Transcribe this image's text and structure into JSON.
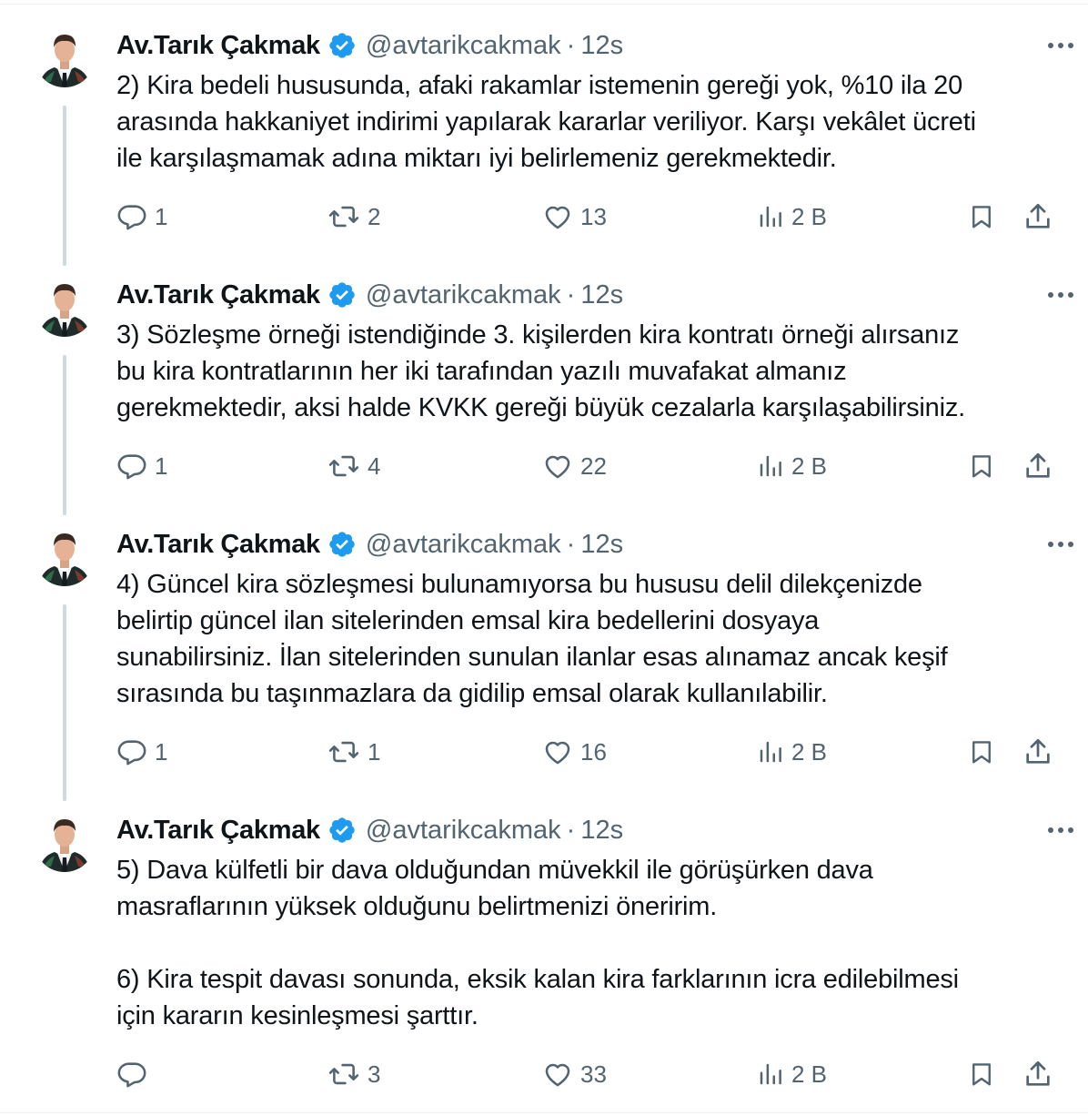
{
  "tweets": [
    {
      "name": "Av.Tarık Çakmak",
      "handle": "@avtarikcakmak",
      "separator": "·",
      "time": "12s",
      "lines": [
        "2) Kira bedeli hususunda, afaki rakamlar istemenin gereği yok, %10 ila 20",
        "arasında hakkaniyet indirimi yapılarak kararlar veriliyor. Karşı vekâlet ücreti",
        "ile karşılaşmamak adına miktarı iyi belirlemeniz gerekmektedir."
      ],
      "replies": "1",
      "retweets": "2",
      "likes": "13",
      "views": "2 B"
    },
    {
      "name": "Av.Tarık Çakmak",
      "handle": "@avtarikcakmak",
      "separator": "·",
      "time": "12s",
      "lines": [
        "3) Sözleşme örneği istendiğinde 3. kişilerden kira kontratı örneği alırsanız",
        "bu kira kontratlarının her iki tarafından yazılı muvafakat almanız",
        "gerekmektedir, aksi halde KVKK gereği büyük cezalarla karşılaşabilirsiniz."
      ],
      "replies": "1",
      "retweets": "4",
      "likes": "22",
      "views": "2 B"
    },
    {
      "name": "Av.Tarık Çakmak",
      "handle": "@avtarikcakmak",
      "separator": "·",
      "time": "12s",
      "lines": [
        "4) Güncel kira sözleşmesi bulunamıyorsa bu hususu delil dilekçenizde",
        "belirtip güncel ilan sitelerinden emsal kira bedellerini dosyaya",
        "sunabilirsiniz. İlan sitelerinden sunulan ilanlar esas alınamaz ancak keşif",
        "sırasında bu taşınmazlara da gidilip emsal olarak kullanılabilir."
      ],
      "replies": "1",
      "retweets": "1",
      "likes": "16",
      "views": "2 B"
    },
    {
      "name": "Av.Tarık Çakmak",
      "handle": "@avtarikcakmak",
      "separator": "·",
      "time": "12s",
      "lines": [
        "5) Dava külfetli bir dava olduğundan müvekkil ile görüşürken dava",
        "masraflarının yüksek olduğunu belirtmenizi öneririm.",
        "",
        "6) Kira tespit davası sonunda, eksik kalan kira farklarının icra edilebilmesi",
        "için kararın kesinleşmesi şarttır."
      ],
      "replies": "",
      "retweets": "3",
      "likes": "33",
      "views": "2 B"
    }
  ],
  "icons": {
    "verified": "verified-badge-icon",
    "more": "more-icon",
    "reply": "reply-icon",
    "retweet": "retweet-icon",
    "like": "heart-icon",
    "views": "views-icon",
    "bookmark": "bookmark-icon",
    "share": "share-icon"
  },
  "colors": {
    "text": "#0f1419",
    "secondary": "#536471",
    "verified": "#1d9bf0",
    "thread_line": "#cfd9de"
  }
}
